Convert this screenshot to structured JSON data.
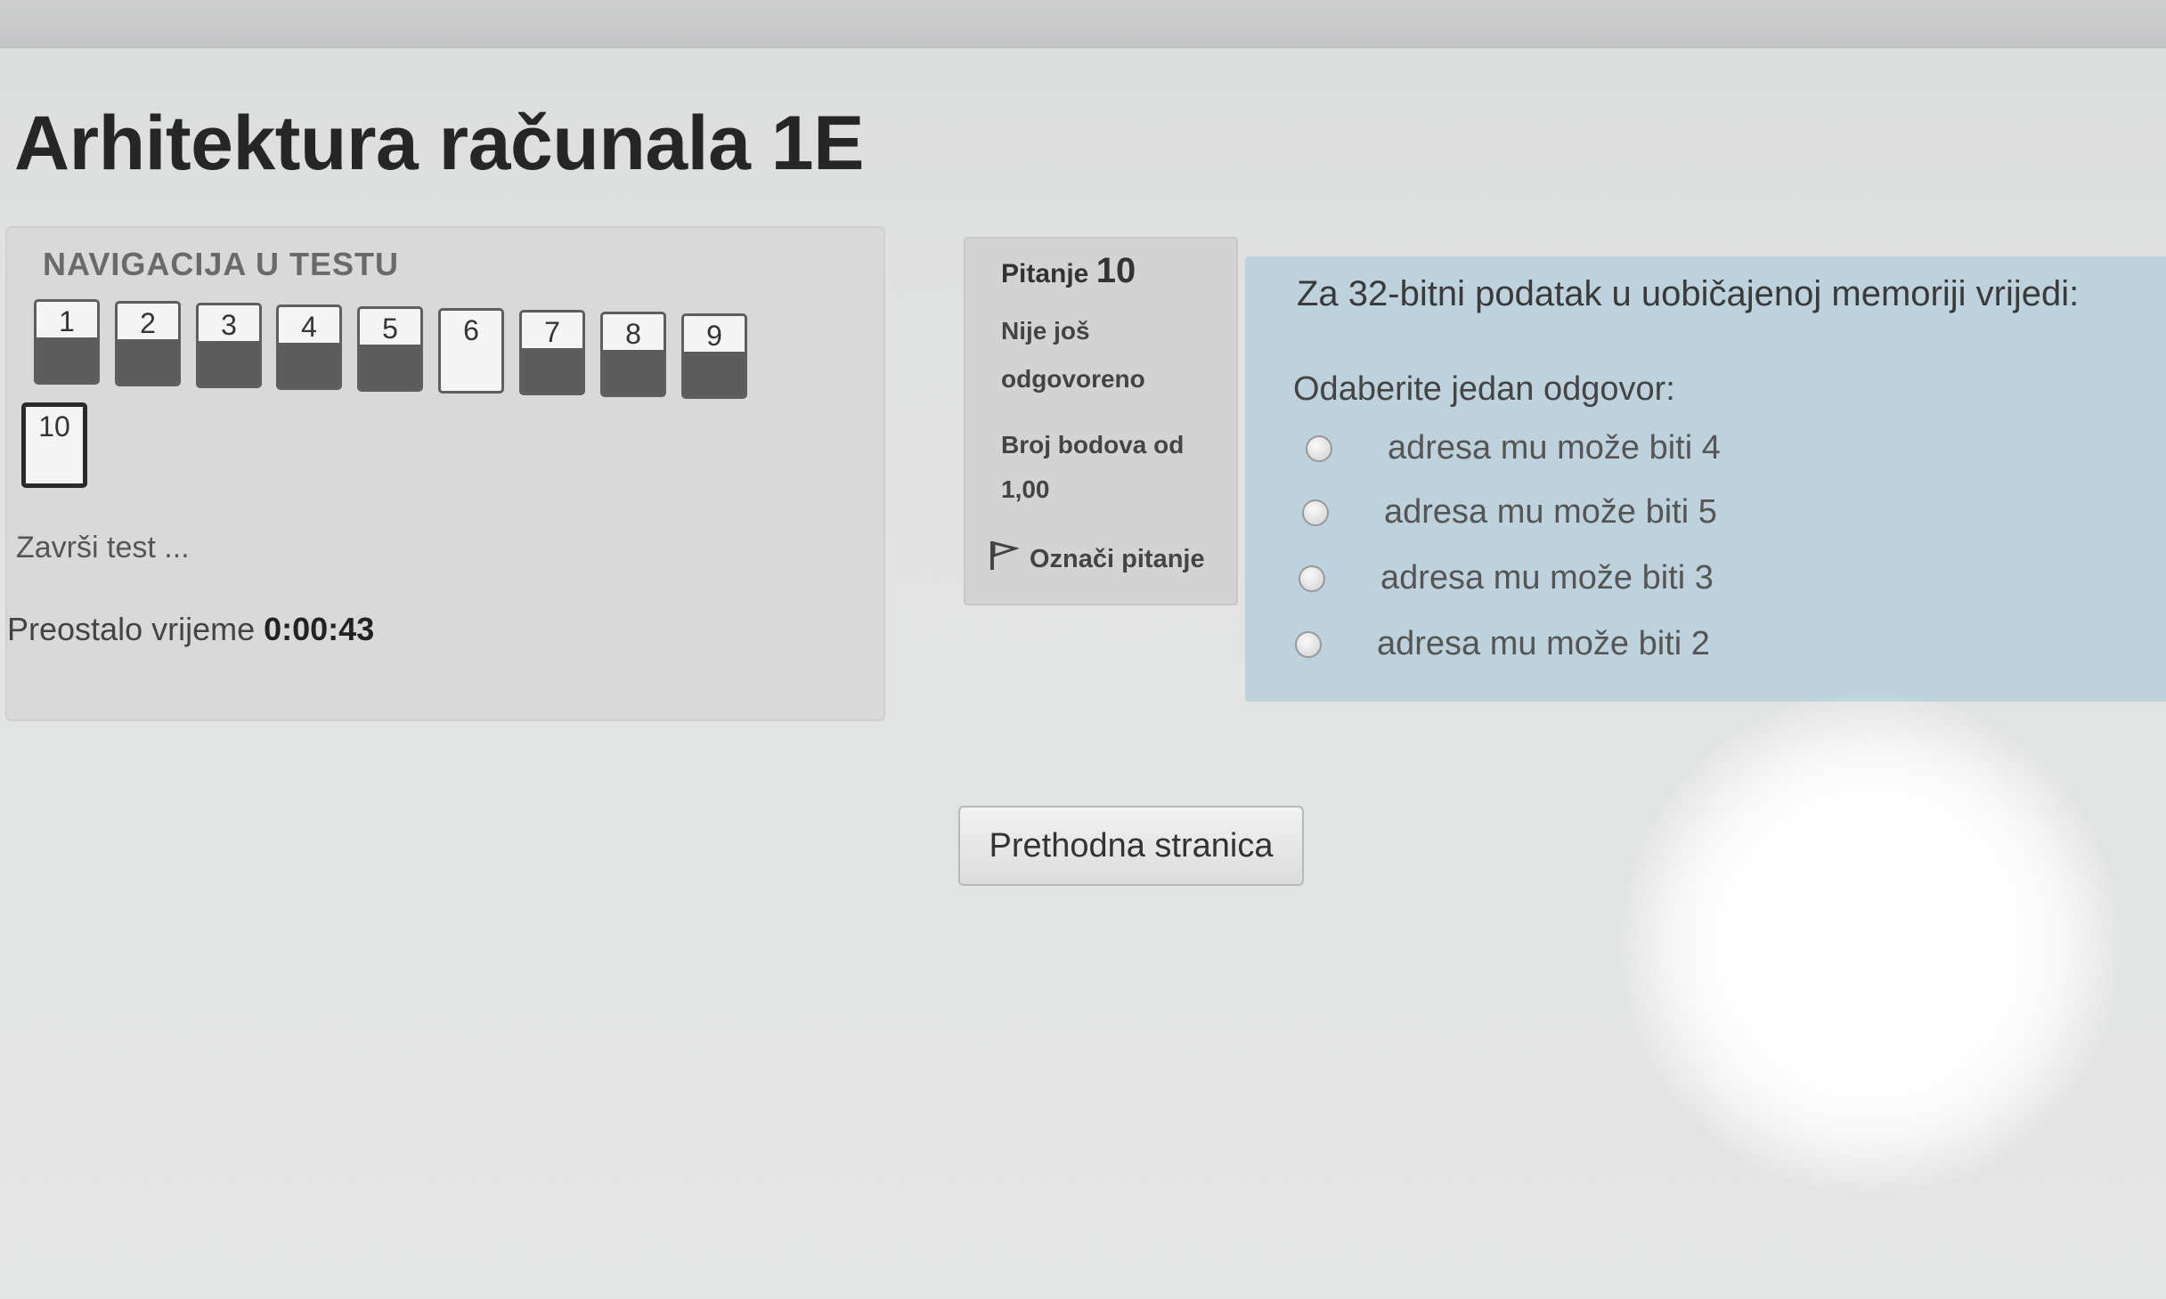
{
  "page": {
    "title": "Arhitektura računala 1E"
  },
  "navigation": {
    "heading": "NAVIGACIJA U TESTU",
    "questions": [
      {
        "label": "1",
        "answered": true
      },
      {
        "label": "2",
        "answered": true
      },
      {
        "label": "3",
        "answered": true
      },
      {
        "label": "4",
        "answered": true
      },
      {
        "label": "5",
        "answered": true
      },
      {
        "label": "6",
        "answered": false
      },
      {
        "label": "7",
        "answered": true
      },
      {
        "label": "8",
        "answered": true
      },
      {
        "label": "9",
        "answered": true
      },
      {
        "label": "10",
        "answered": false,
        "current": true
      }
    ],
    "finish_label": "Završi test ...",
    "time_label": "Preostalo vrijeme",
    "time_value": "0:00:43"
  },
  "question_info": {
    "label": "Pitanje",
    "number": "10",
    "status_line1": "Nije još",
    "status_line2": "odgovoreno",
    "points_line1": "Broj bodova od",
    "points_line2": "1,00",
    "flag_label": "Označi pitanje",
    "flag_icon": "flag-icon"
  },
  "question": {
    "text": "Za 32-bitni podatak u uobičajenoj memoriji vrijedi:",
    "prompt": "Odaberite jedan odgovor:",
    "answers": [
      "adresa mu može biti 4",
      "adresa mu može biti 5",
      "adresa mu može biti 3",
      "adresa mu može biti 2"
    ]
  },
  "footer": {
    "prev_button": "Prethodna stranica"
  }
}
